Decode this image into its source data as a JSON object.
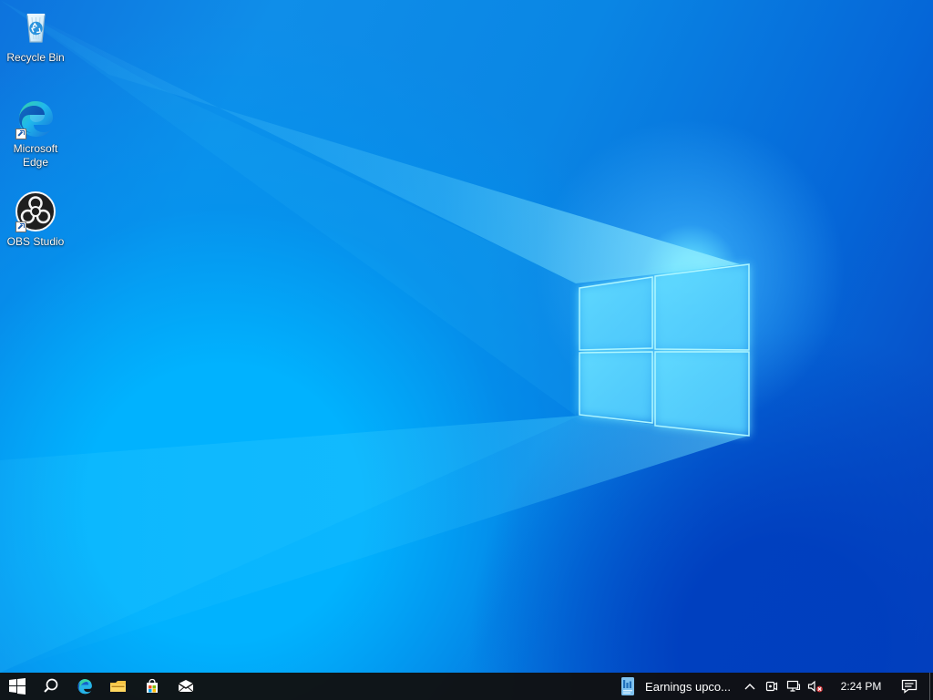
{
  "desktop": {
    "icons": [
      {
        "label": "Recycle Bin",
        "icon": "recycle-bin-icon"
      },
      {
        "label": "Microsoft Edge",
        "icon": "microsoft-edge-icon"
      },
      {
        "label": "OBS Studio",
        "icon": "obs-studio-icon"
      }
    ],
    "wallpaper": {
      "accent_colors": [
        "#0d73dd",
        "#0f8ee9",
        "#0567d8",
        "#073fbd",
        "#5fdbff"
      ]
    }
  },
  "taskbar": {
    "pinned": [
      "windows-start-icon",
      "search-icon",
      "microsoft-edge-icon",
      "file-explorer-icon",
      "microsoft-store-icon",
      "mail-icon"
    ],
    "news_widget": {
      "text": "Earnings upco..."
    },
    "tray": {
      "icons": [
        "chevron-up-icon",
        "meet-now-icon",
        "network-icon",
        "volume-muted-icon"
      ],
      "time": "2:24 PM"
    }
  }
}
